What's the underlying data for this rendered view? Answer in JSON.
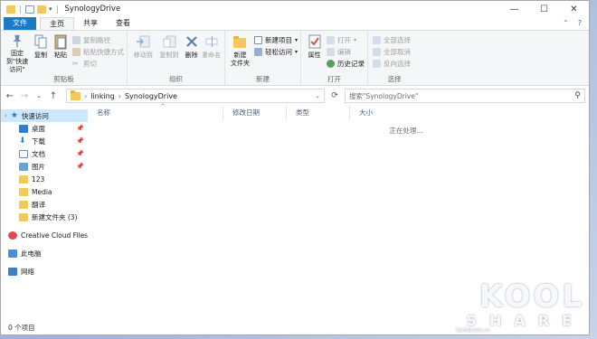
{
  "window": {
    "title": "SynologyDrive"
  },
  "titlebar_controls": {
    "minimize": "—",
    "maximize": "☐",
    "close": "✕"
  },
  "tabs": [
    {
      "label": "文件"
    },
    {
      "label": "主页"
    },
    {
      "label": "共享"
    },
    {
      "label": "查看"
    }
  ],
  "ribbon": {
    "clipboard": {
      "label": "剪贴板",
      "pin_quick_access": "固定到\"快速访问\"",
      "copy": "复制",
      "paste": "粘贴",
      "copy_path": "复制路径",
      "paste_shortcut": "粘贴快捷方式",
      "cut": "剪切"
    },
    "organize": {
      "label": "组织",
      "move_to": "移动到",
      "copy_to": "复制到",
      "delete": "删除",
      "rename": "重命名"
    },
    "new": {
      "label": "新建",
      "new_folder": "新建\n文件夹",
      "new_item": "新建项目",
      "easy_access": "轻松访问"
    },
    "open": {
      "label": "打开",
      "properties": "属性",
      "open": "打开",
      "edit": "编辑",
      "history": "历史记录"
    },
    "select": {
      "label": "选择",
      "select_all": "全部选择",
      "select_none": "全部取消",
      "invert": "反向选择"
    }
  },
  "address": {
    "path": [
      "linking",
      "SynologyDrive"
    ],
    "search_placeholder": "搜索\"SynologyDrive\""
  },
  "nav": {
    "quick_access": "快速访问",
    "items": [
      {
        "label": "桌面",
        "pinned": true
      },
      {
        "label": "下载",
        "pinned": true
      },
      {
        "label": "文档",
        "pinned": true
      },
      {
        "label": "图片",
        "pinned": true
      },
      {
        "label": "123"
      },
      {
        "label": "Media"
      },
      {
        "label": "翻译"
      },
      {
        "label": "新建文件夹 (3)"
      }
    ],
    "creative_cloud": "Creative Cloud Files",
    "this_pc": "此电脑",
    "network": "网络"
  },
  "columns": [
    "名称",
    "修改日期",
    "类型",
    "大小"
  ],
  "processing_text": "正在处理...",
  "status": {
    "item_count": "0 个项目"
  },
  "watermark": {
    "main": "KOOL",
    "sub": "SHARE",
    "url": "koolshare.cn"
  },
  "colors": {
    "file_tab": "#1979ca",
    "folder": "#f4c95b",
    "selection": "#cce8ff"
  }
}
